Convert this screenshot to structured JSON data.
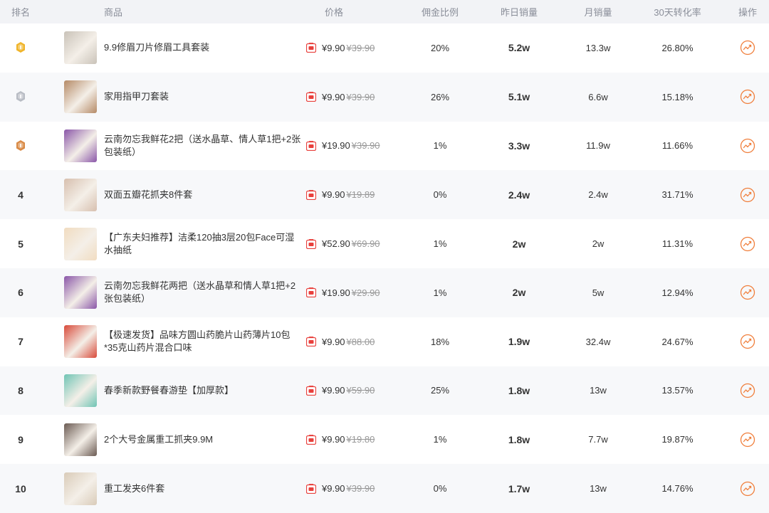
{
  "headers": {
    "rank": "排名",
    "product": "商品",
    "price": "价格",
    "commission": "佣金比例",
    "yesterday_sales": "昨日销量",
    "monthly_sales": "月销量",
    "conversion": "30天转化率",
    "action": "操作"
  },
  "colors": {
    "gold": "#f0b429",
    "silver": "#b8bcc4",
    "bronze": "#d98a45",
    "price_tag": "#e8403c",
    "action": "#f07f3c"
  },
  "rows": [
    {
      "rank": "1",
      "medal": "gold",
      "name": "9.9修眉刀片修眉工具套装",
      "price": "¥9.90",
      "old_price": "¥39.90",
      "commission": "20%",
      "yesterday": "5.2w",
      "monthly": "13.3w",
      "conversion": "26.80%",
      "thumb_color": "#c9c2b8"
    },
    {
      "rank": "2",
      "medal": "silver",
      "name": "家用指甲刀套装",
      "price": "¥9.90",
      "old_price": "¥39.90",
      "commission": "26%",
      "yesterday": "5.1w",
      "monthly": "6.6w",
      "conversion": "15.18%",
      "thumb_color": "#b58a66"
    },
    {
      "rank": "3",
      "medal": "bronze",
      "name": "云南勿忘我鲜花2把（送水晶草、情人草1把+2张包装纸）",
      "price": "¥19.90",
      "old_price": "¥39.90",
      "commission": "1%",
      "yesterday": "3.3w",
      "monthly": "11.9w",
      "conversion": "11.66%",
      "thumb_color": "#8a56a8"
    },
    {
      "rank": "4",
      "medal": "",
      "name": "双面五瓣花抓夹8件套",
      "price": "¥9.90",
      "old_price": "¥19.89",
      "commission": "0%",
      "yesterday": "2.4w",
      "monthly": "2.4w",
      "conversion": "31.71%",
      "thumb_color": "#d7bfae"
    },
    {
      "rank": "5",
      "medal": "",
      "name": "【广东夫妇推荐】洁柔120抽3层20包Face可湿水抽纸",
      "price": "¥52.90",
      "old_price": "¥69.90",
      "commission": "1%",
      "yesterday": "2w",
      "monthly": "2w",
      "conversion": "11.31%",
      "thumb_color": "#f1dcc0"
    },
    {
      "rank": "6",
      "medal": "",
      "name": "云南勿忘我鲜花两把（送水晶草和情人草1把+2张包装纸）",
      "price": "¥19.90",
      "old_price": "¥29.90",
      "commission": "1%",
      "yesterday": "2w",
      "monthly": "5w",
      "conversion": "12.94%",
      "thumb_color": "#8a56a8"
    },
    {
      "rank": "7",
      "medal": "",
      "name": "【极速发货】品味方圆山药脆片山药薄片10包*35克山药片混合口味",
      "price": "¥9.90",
      "old_price": "¥88.00",
      "commission": "18%",
      "yesterday": "1.9w",
      "monthly": "32.4w",
      "conversion": "24.67%",
      "thumb_color": "#d84a3a"
    },
    {
      "rank": "8",
      "medal": "",
      "name": "春季新款野餐春游垫【加厚款】",
      "price": "¥9.90",
      "old_price": "¥59.90",
      "commission": "25%",
      "yesterday": "1.8w",
      "monthly": "13w",
      "conversion": "13.57%",
      "thumb_color": "#6fc4b4"
    },
    {
      "rank": "9",
      "medal": "",
      "name": "2个大号金属重工抓夹9.9M",
      "price": "¥9.90",
      "old_price": "¥19.80",
      "commission": "1%",
      "yesterday": "1.8w",
      "monthly": "7.7w",
      "conversion": "19.87%",
      "thumb_color": "#6a5a52"
    },
    {
      "rank": "10",
      "medal": "",
      "name": "重工发夹6件套",
      "price": "¥9.90",
      "old_price": "¥39.90",
      "commission": "0%",
      "yesterday": "1.7w",
      "monthly": "13w",
      "conversion": "14.76%",
      "thumb_color": "#d9cbb8"
    }
  ]
}
